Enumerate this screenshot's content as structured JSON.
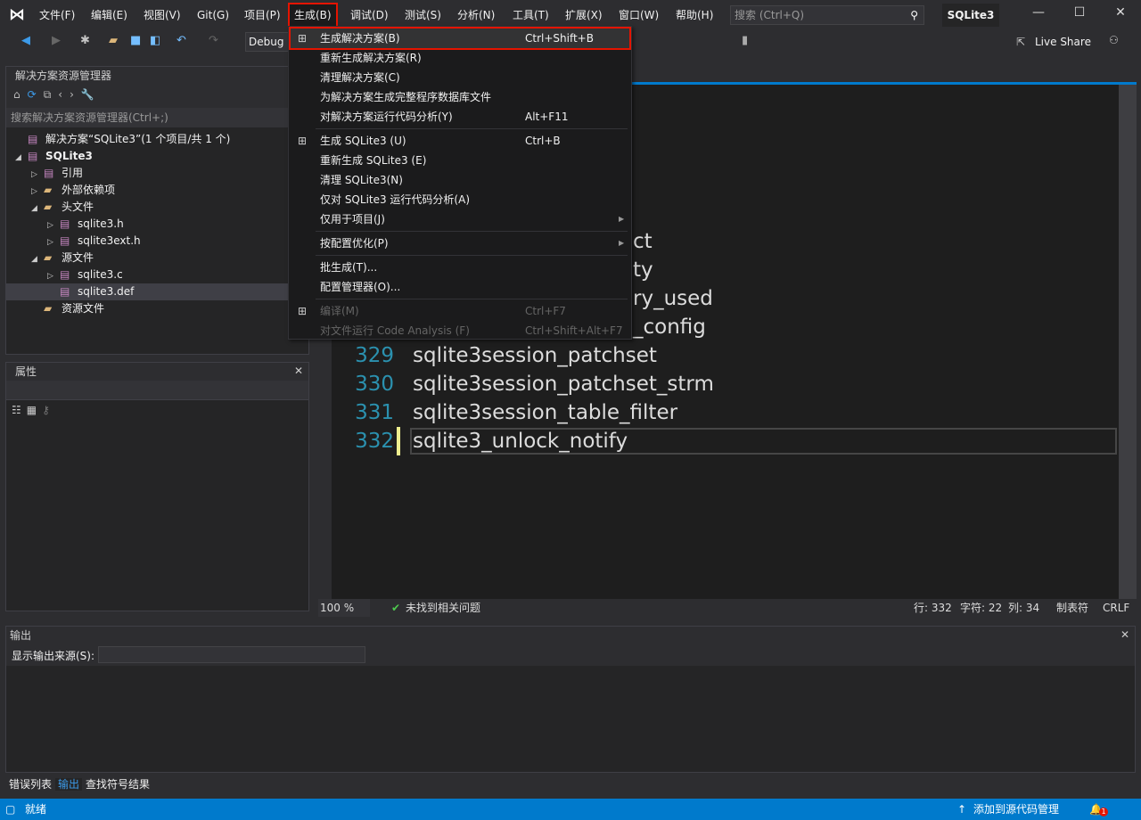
{
  "app": {
    "title": "SQLite3",
    "search_placeholder": "搜索 (Ctrl+Q)"
  },
  "menu": [
    "文件(F)",
    "编辑(E)",
    "视图(V)",
    "Git(G)",
    "项目(P)",
    "生成(B)",
    "调试(D)",
    "测试(S)",
    "分析(N)",
    "工具(T)",
    "扩展(X)",
    "窗口(W)",
    "帮助(H)"
  ],
  "toolbar": {
    "config": "Debug",
    "live_share": "Live Share"
  },
  "solution_explorer": {
    "title": "解决方案资源管理器",
    "search_placeholder": "搜索解决方案资源管理器(Ctrl+;)",
    "tree": [
      {
        "label": "解决方案“SQLite3”(1 个项目/共 1 个)",
        "indent": 0,
        "expander": "",
        "icon": "solution-icon"
      },
      {
        "label": "SQLite3",
        "indent": 1,
        "expander": "◢",
        "icon": "project-icon",
        "bold": true
      },
      {
        "label": "引用",
        "indent": 2,
        "expander": "▷",
        "icon": "references-icon"
      },
      {
        "label": "外部依赖项",
        "indent": 2,
        "expander": "▷",
        "icon": "external-deps-icon"
      },
      {
        "label": "头文件",
        "indent": 2,
        "expander": "◢",
        "icon": "filter-folder-icon"
      },
      {
        "label": "sqlite3.h",
        "indent": 3,
        "expander": "▷",
        "icon": "header-file-icon"
      },
      {
        "label": "sqlite3ext.h",
        "indent": 3,
        "expander": "▷",
        "icon": "header-file-icon"
      },
      {
        "label": "源文件",
        "indent": 2,
        "expander": "◢",
        "icon": "filter-folder-icon"
      },
      {
        "label": "sqlite3.c",
        "indent": 3,
        "expander": "▷",
        "icon": "c-file-icon"
      },
      {
        "label": "sqlite3.def",
        "indent": 3,
        "expander": "",
        "icon": "def-file-icon",
        "selected": true
      },
      {
        "label": "资源文件",
        "indent": 2,
        "expander": "",
        "icon": "filter-folder-icon"
      }
    ]
  },
  "properties": {
    "title": "属性"
  },
  "build_menu": {
    "items": [
      {
        "label": "生成解决方案(B)",
        "shortcut": "Ctrl+Shift+B",
        "icon": "build-icon",
        "highlighted": true
      },
      {
        "label": "重新生成解决方案(R)",
        "shortcut": ""
      },
      {
        "label": "清理解决方案(C)",
        "shortcut": ""
      },
      {
        "label": "为解决方案生成完整程序数据库文件",
        "shortcut": ""
      },
      {
        "label": "对解决方案运行代码分析(Y)",
        "shortcut": "Alt+F11",
        "sep_after": true
      },
      {
        "label": "生成 SQLite3 (U)",
        "shortcut": "Ctrl+B",
        "icon": "build-icon"
      },
      {
        "label": "重新生成 SQLite3 (E)",
        "shortcut": ""
      },
      {
        "label": "清理 SQLite3(N)",
        "shortcut": ""
      },
      {
        "label": "仅对 SQLite3 运行代码分析(A)",
        "shortcut": ""
      },
      {
        "label": "仅用于项目(J)",
        "shortcut": "",
        "submenu": true,
        "sep_after": true
      },
      {
        "label": "按配置优化(P)",
        "shortcut": "",
        "submenu": true,
        "sep_after": true
      },
      {
        "label": "批生成(T)...",
        "shortcut": ""
      },
      {
        "label": "配置管理器(O)...",
        "shortcut": "",
        "sep_after": true
      },
      {
        "label": "编译(M)",
        "shortcut": "Ctrl+F7",
        "disabled": true,
        "icon": "compile-icon"
      },
      {
        "label": "对文件运行 Code Analysis (F)",
        "shortcut": "Ctrl+Shift+Alt+F7",
        "disabled": true
      }
    ]
  },
  "editor": {
    "partial_lines": [
      "ct",
      "ty",
      "ry_used",
      "_config"
    ],
    "lines": [
      {
        "num": "329",
        "text": "sqlite3session_patchset"
      },
      {
        "num": "330",
        "text": "sqlite3session_patchset_strm"
      },
      {
        "num": "331",
        "text": "sqlite3session_table_filter"
      },
      {
        "num": "332",
        "text": "sqlite3_unlock_notify"
      }
    ],
    "zoom": "100 %",
    "issues": "未找到相关问题",
    "row": "行: 332",
    "char": "字符: 22",
    "col": "列: 34",
    "indent": "制表符",
    "eol": "CRLF"
  },
  "output": {
    "title": "输出",
    "source_label": "显示输出来源(S):"
  },
  "bottom_tabs": [
    "错误列表",
    "输出",
    "查找符号结果"
  ],
  "status": {
    "ready": "就绪",
    "source_control": "添加到源代码管理",
    "notification_count": "1",
    "accent": "#007acc"
  }
}
